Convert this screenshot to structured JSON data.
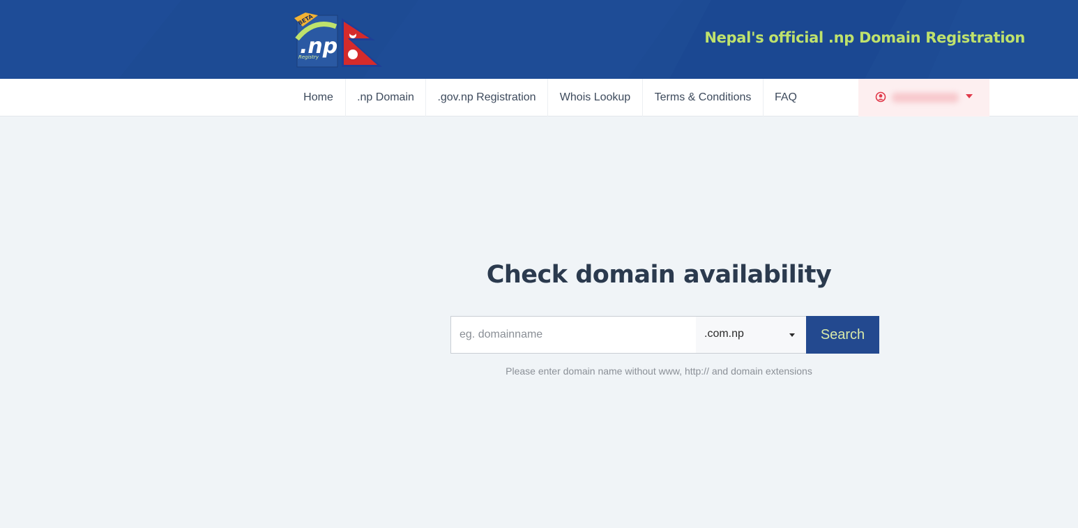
{
  "header": {
    "tagline": "Nepal's official .np Domain Registration",
    "logo_text": ".np",
    "logo_badge": "BETA",
    "logo_subtext": "Registry",
    "accent_color": "#bfe26c",
    "brand_color": "#1d4b94"
  },
  "nav": {
    "items": [
      {
        "label": "Home"
      },
      {
        "label": ".np Domain"
      },
      {
        "label": ".gov.np Registration"
      },
      {
        "label": "Whois Lookup"
      },
      {
        "label": "Terms & Conditions"
      },
      {
        "label": "FAQ"
      }
    ],
    "account": {
      "icon": "user-circle-icon",
      "name_hidden": true
    }
  },
  "main": {
    "title": "Check domain availability",
    "search": {
      "placeholder": "eg. domainname",
      "value": "",
      "extension": ".com.np",
      "button_label": "Search"
    },
    "hint": "Please enter domain name without www, http:// and domain extensions"
  }
}
